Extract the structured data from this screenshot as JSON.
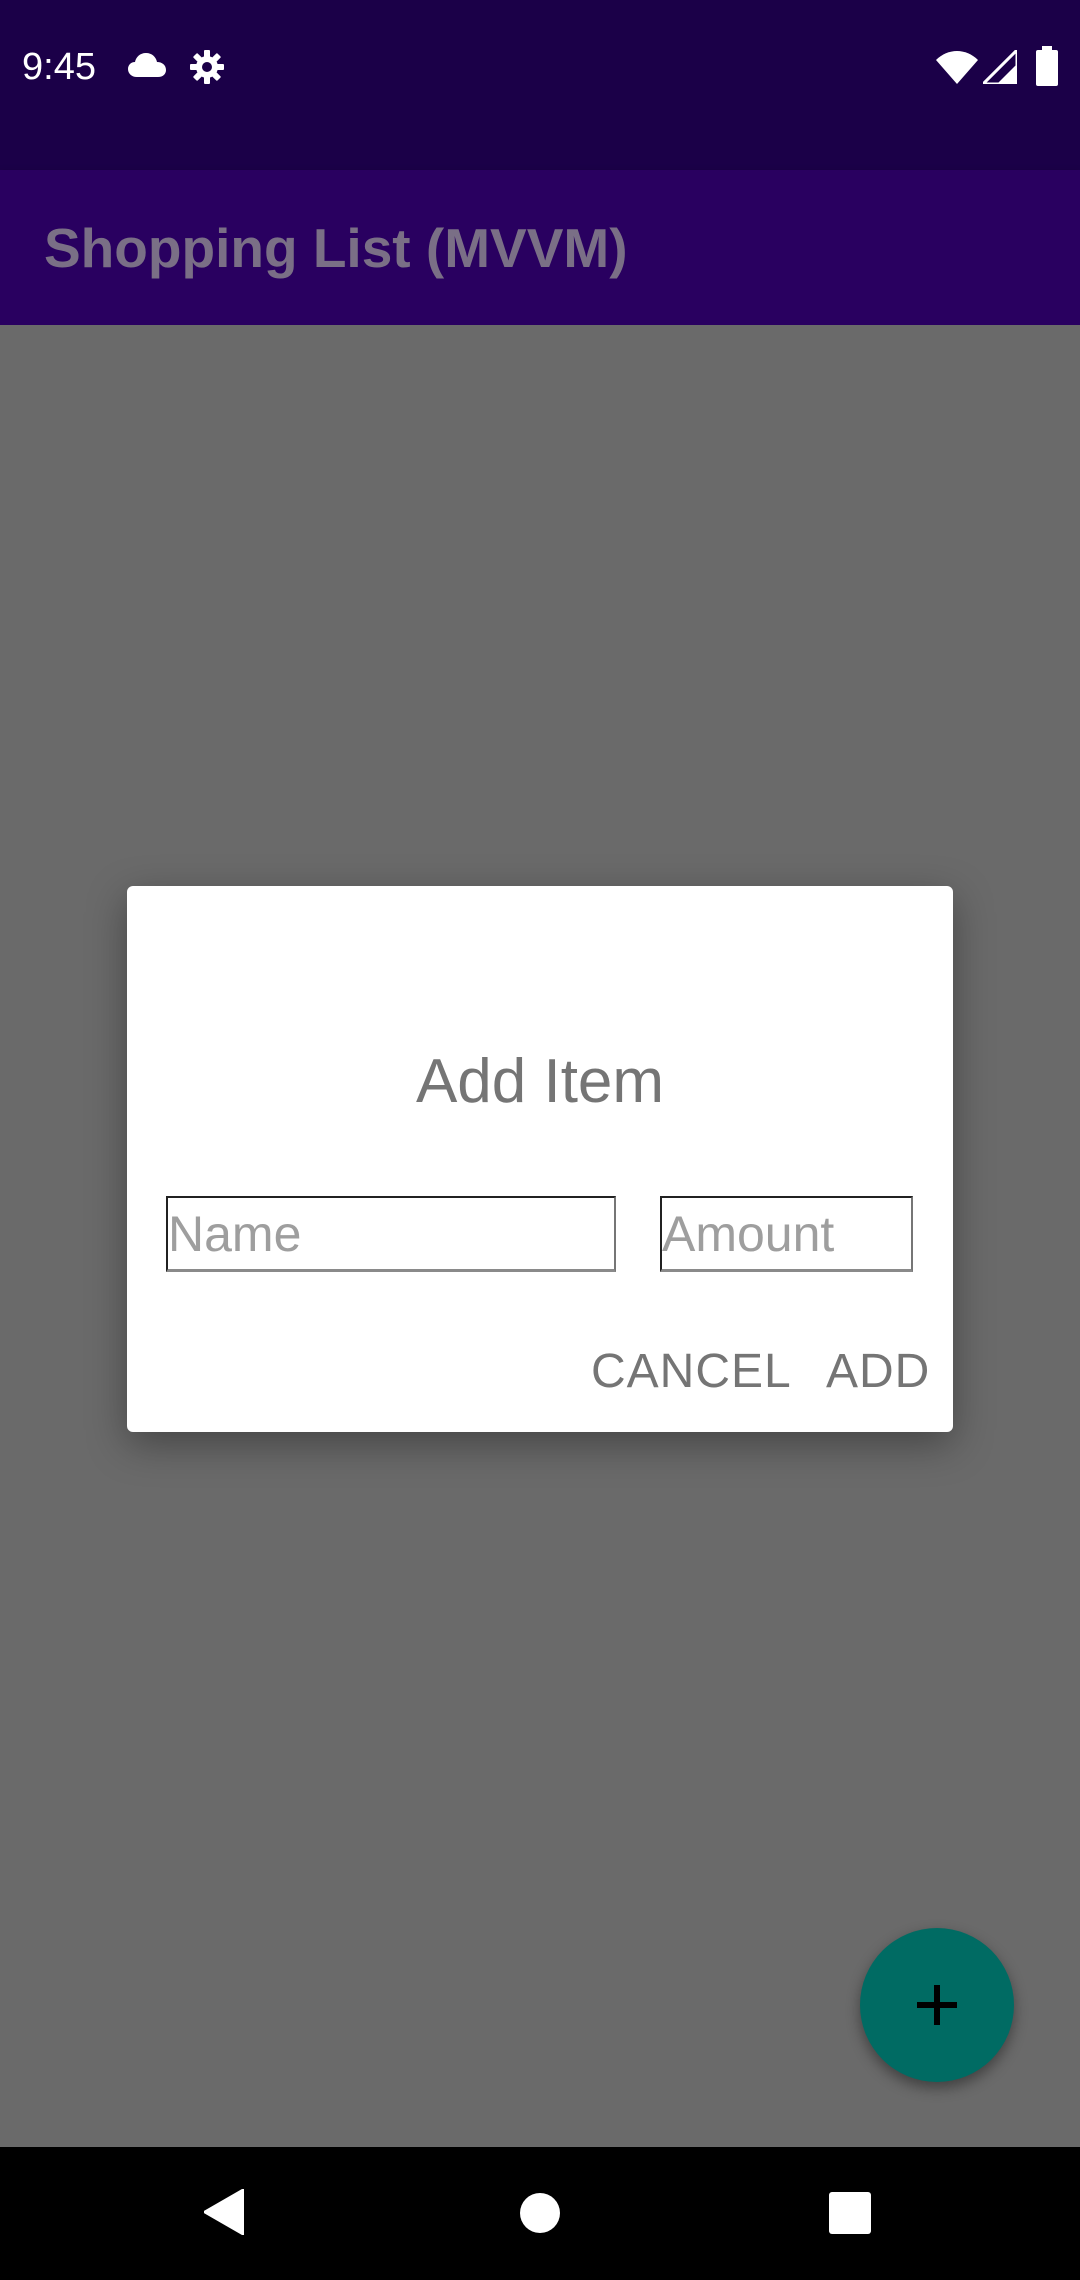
{
  "status_bar": {
    "time": "9:45",
    "icons": [
      "cloud-icon",
      "gear-icon",
      "wifi-icon",
      "signal-icon",
      "battery-icon"
    ]
  },
  "app_bar": {
    "title": "Shopping List (MVVM)"
  },
  "dialog": {
    "title": "Add Item",
    "name_placeholder": "Name",
    "amount_placeholder": "Amount",
    "cancel_label": "CANCEL",
    "add_label": "ADD"
  },
  "fab": {
    "icon": "plus-icon"
  },
  "nav_bar": {
    "icons": [
      "back-icon",
      "home-icon",
      "recents-icon"
    ]
  },
  "colors": {
    "status_bar": "#1b0048",
    "app_bar": "#290060",
    "scrim_background": "#6a6a6a",
    "fab": "#006b63"
  }
}
